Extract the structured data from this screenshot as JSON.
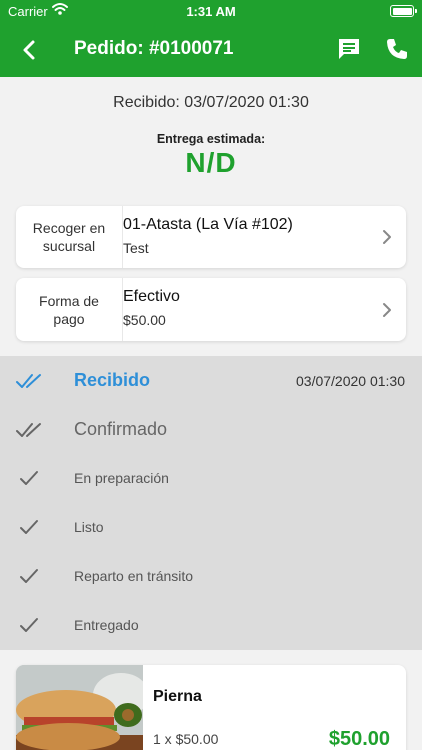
{
  "status_bar": {
    "carrier": "Carrier",
    "time": "1:31 AM"
  },
  "nav": {
    "title": "Pedido: #0100071",
    "back_icon": "chevron-left-icon",
    "chat_icon": "chat-bubble-icon",
    "phone_icon": "phone-icon"
  },
  "order": {
    "received": "Recibido: 03/07/2020 01:30",
    "eta_label": "Entrega estimada:",
    "eta_value": "N/D"
  },
  "pickup_card": {
    "label": "Recoger en sucursal",
    "title": "01-Atasta (La Vía #102)",
    "subtitle": "Test"
  },
  "payment_card": {
    "label": "Forma de pago",
    "title": "Efectivo",
    "subtitle": "$50.00"
  },
  "timeline": {
    "steps": [
      {
        "label": "Recibido",
        "date": "03/07/2020 01:30",
        "state": "active"
      },
      {
        "label": "Confirmado",
        "date": "",
        "state": "pending"
      },
      {
        "label": "En preparación",
        "date": "",
        "state": "pending"
      },
      {
        "label": "Listo",
        "date": "",
        "state": "pending"
      },
      {
        "label": "Reparto en tránsito",
        "date": "",
        "state": "pending"
      },
      {
        "label": "Entregado",
        "date": "",
        "state": "pending"
      }
    ]
  },
  "product": {
    "name": "Pierna",
    "qty": "1 x $50.00",
    "price": "$50.00"
  },
  "colors": {
    "brand_green": "#1fa12e",
    "active_blue": "#2e8fd8",
    "timeline_bg": "#dcdcdc"
  }
}
